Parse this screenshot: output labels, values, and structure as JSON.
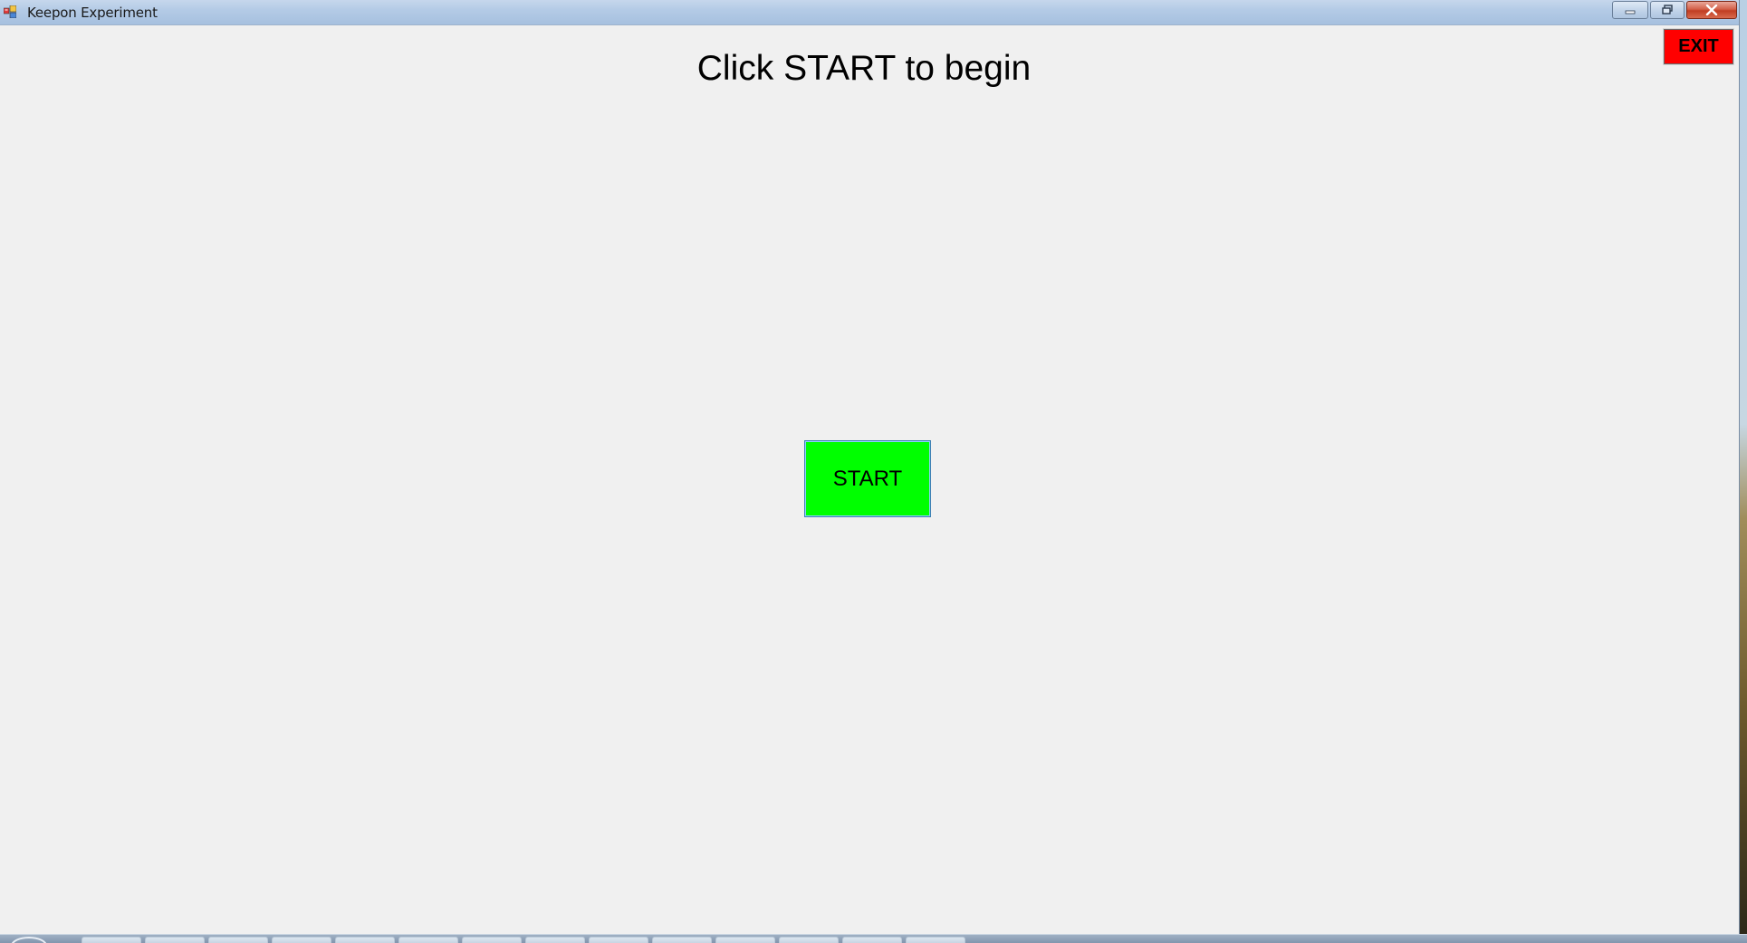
{
  "window": {
    "title": "Keepon Experiment",
    "app_icon": "windows-form-icon",
    "controls": {
      "minimize_icon": "minimize-icon",
      "maximize_icon": "restore-icon",
      "close_icon": "close-icon"
    }
  },
  "main": {
    "heading": "Click START to begin",
    "start_label": "START",
    "exit_label": "EXIT"
  },
  "colors": {
    "start_button": "#00ff00",
    "exit_button": "#ff0000",
    "background": "#f0f0f0"
  }
}
